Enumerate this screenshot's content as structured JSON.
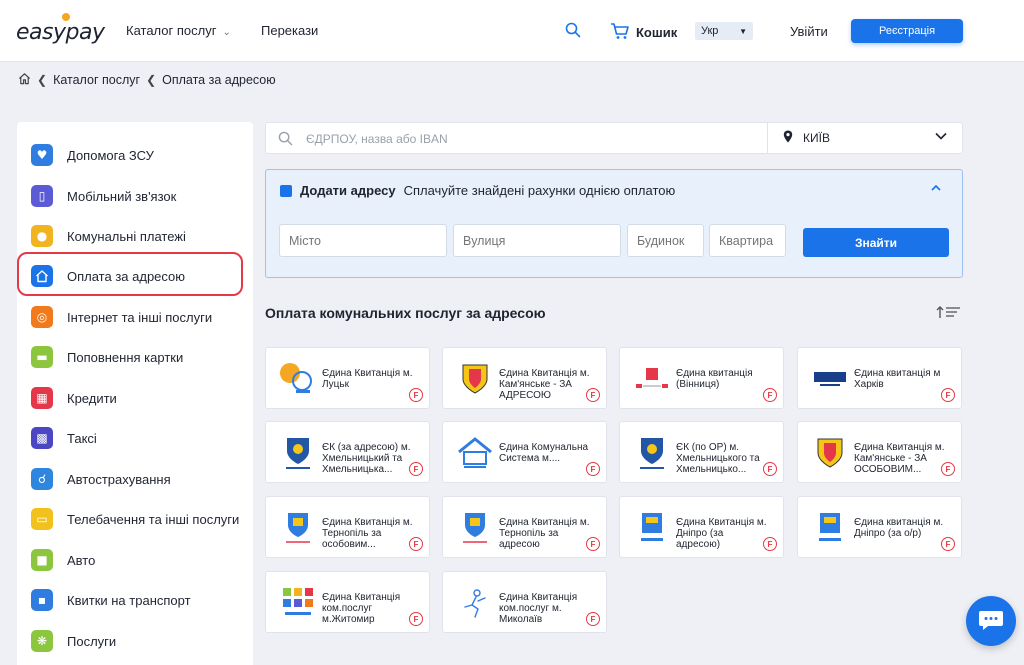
{
  "header": {
    "logo_text": "easypay",
    "catalog_label": "Каталог послуг",
    "transfers_label": "Перекази",
    "cart_label": "Кошик",
    "lang_value": "Укр",
    "login_label": "Увійти",
    "register_label": "Реєстрація"
  },
  "breadcrumb": {
    "items": [
      "Каталог послуг",
      "Оплата за адресою"
    ]
  },
  "sidebar": {
    "items": [
      {
        "label": "Допомога ЗСУ",
        "color": "#2f7de1"
      },
      {
        "label": "Мобільний зв'язок",
        "color": "#5b5bd6"
      },
      {
        "label": "Комунальні платежі",
        "color": "#f2b320"
      },
      {
        "label": "Оплата за адресою",
        "color": "#1a73e8"
      },
      {
        "label": "Інтернет та інші послуги",
        "color": "#f07a1c"
      },
      {
        "label": "Поповнення картки",
        "color": "#8cc63f"
      },
      {
        "label": "Кредити",
        "color": "#e5374a"
      },
      {
        "label": "Таксі",
        "color": "#4b46c4"
      },
      {
        "label": "Автострахування",
        "color": "#2f86de"
      },
      {
        "label": "Телебачення та інші послуги",
        "color": "#f2c21c"
      },
      {
        "label": "Авто",
        "color": "#8cc63f"
      },
      {
        "label": "Квитки на транспорт",
        "color": "#2f7de1"
      },
      {
        "label": "Послуги",
        "color": "#8cc63f"
      }
    ]
  },
  "search": {
    "placeholder": "ЄДРПОУ, назва або IBAN",
    "city_value": "КИЇВ"
  },
  "address_panel": {
    "title": "Додати адресу",
    "subtitle": "Сплачуйте знайдені рахунки однією оплатою",
    "city_placeholder": "Місто",
    "street_placeholder": "Вулиця",
    "building_placeholder": "Будинок",
    "apartment_placeholder": "Квартира",
    "find_label": "Знайти"
  },
  "section_title": "Оплата комунальних послуг за адресою",
  "cards": [
    {
      "name": "Єдина Квитанція м. Луцьк",
      "logo_color": "#f5a623"
    },
    {
      "name": "Єдина Квитанція м. Кам'янське - ЗА АДРЕСОЮ",
      "logo_color": "#e5374a"
    },
    {
      "name": "Єдина квитанція (Вінниця)",
      "logo_color": "#e5374a"
    },
    {
      "name": "Єдина квитанція м Харків",
      "logo_color": "#1a3f8a"
    },
    {
      "name": "ЄК (за адресою) м. Хмельницький та Хмельницька...",
      "logo_color": "#2456a6"
    },
    {
      "name": "Єдина Комунальна Система м....",
      "logo_color": "#2f7de1"
    },
    {
      "name": "ЄК (по ОР) м. Хмельницького та Хмельницько...",
      "logo_color": "#2456a6"
    },
    {
      "name": "Єдина Квитанція м. Кам'янське - ЗА ОСОБОВИМ...",
      "logo_color": "#e5374a"
    },
    {
      "name": "Єдина Квитанція м. Тернопіль за особовим...",
      "logo_color": "#e5374a"
    },
    {
      "name": "Єдина Квитанція м. Тернопіль за адресою",
      "logo_color": "#e5374a"
    },
    {
      "name": "Єдина Квитанція м. Дніпро (за адресою)",
      "logo_color": "#2f7de1"
    },
    {
      "name": "Єдина квитанція м. Дніпро (за о/р)",
      "logo_color": "#2f7de1"
    },
    {
      "name": "Єдина Квитанція ком.послуг м.Житомир",
      "logo_color": "#8cc63f"
    },
    {
      "name": "Єдина Квитанція ком.послуг м. Миколаїв",
      "logo_color": "#2f7de1"
    }
  ],
  "badge_letter": "F"
}
